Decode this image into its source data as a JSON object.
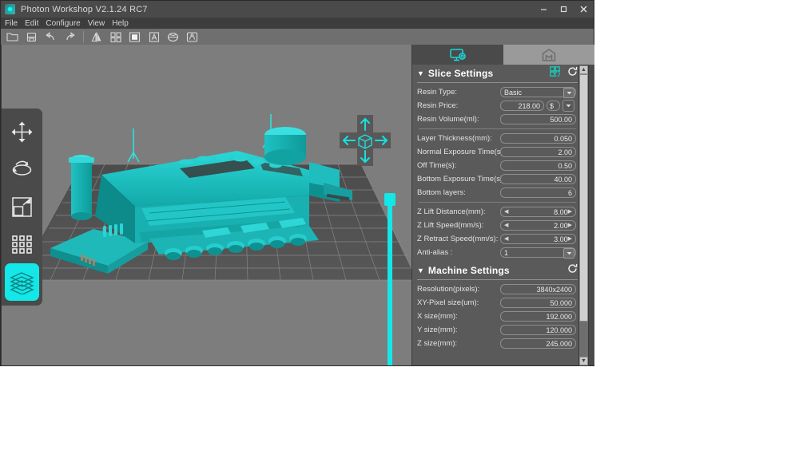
{
  "window": {
    "title": "Photon Workshop V2.1.24 RC7",
    "logo_icon": "photon-logo-icon",
    "controls": [
      {
        "name": "minimize-button",
        "glyph": "minimize-icon"
      },
      {
        "name": "maximize-button",
        "glyph": "maximize-icon"
      },
      {
        "name": "close-button",
        "glyph": "close-icon"
      }
    ]
  },
  "menubar": {
    "items": [
      {
        "label": "File"
      },
      {
        "label": "Edit"
      },
      {
        "label": "Configure"
      },
      {
        "label": "View"
      },
      {
        "label": "Help"
      }
    ]
  },
  "toolbar": {
    "buttons": [
      {
        "name": "open-file-button",
        "icon": "folder-open-icon"
      },
      {
        "name": "save-file-button",
        "icon": "save-disk-icon"
      },
      {
        "name": "undo-button",
        "icon": "undo-arrow-icon"
      },
      {
        "name": "redo-button",
        "icon": "redo-arrow-icon"
      },
      {
        "name": "mirror-button",
        "icon": "mirror-triangles-icon"
      },
      {
        "name": "hollow-button",
        "icon": "scatter-diamonds-icon"
      },
      {
        "name": "solid-view-button",
        "icon": "solid-square-icon"
      },
      {
        "name": "text-button",
        "icon": "letter-a-icon"
      },
      {
        "name": "hollow-sphere-button",
        "icon": "sliced-sphere-icon"
      },
      {
        "name": "supports-button",
        "icon": "support-model-icon"
      }
    ]
  },
  "viewport": {
    "tools": [
      {
        "name": "move-tool",
        "icon": "move-arrows-icon",
        "selected": false
      },
      {
        "name": "rotate-tool",
        "icon": "rotate-orbit-icon",
        "selected": false
      },
      {
        "name": "scale-tool",
        "icon": "scale-square-icon",
        "selected": false
      },
      {
        "name": "array-tool",
        "icon": "grid-dots-icon",
        "selected": false
      },
      {
        "name": "slice-tool",
        "icon": "layers-stack-icon",
        "selected": true
      }
    ],
    "gizmo": {
      "name": "view-navigation-gizmo",
      "center_icon": "cube-icon",
      "up_icon": "arrow-up-icon",
      "down_icon": "arrow-down-icon",
      "left_icon": "arrow-left-icon",
      "right_icon": "arrow-right-icon"
    },
    "z_slider": {
      "name": "z-height-slider"
    },
    "model": {
      "name": "locomotive-model",
      "color": "#17bfbf"
    },
    "background_color": "#7d7d7d",
    "plate_color": "#4f4f4f"
  },
  "panel": {
    "tabs": [
      {
        "name": "tab-slice-settings",
        "icon": "monitor-settings-icon",
        "active": true
      },
      {
        "name": "tab-print-preview",
        "icon": "printer-box-icon",
        "active": false
      }
    ],
    "slice": {
      "title": "Slice Settings",
      "caret": "▼",
      "copy_icon": "copy-settings-icon",
      "reset_icon": "reset-refresh-icon",
      "rows": [
        {
          "label": "Resin Type:",
          "value": "Basic",
          "type": "dropdown",
          "align": "left"
        },
        {
          "label": "Resin Price:",
          "value": "218.00",
          "currency": "$",
          "type": "price"
        },
        {
          "label": "Resin Volume(ml):",
          "value": "500.00",
          "type": "text"
        },
        {
          "label": "Layer Thickness(mm):",
          "value": "0.050",
          "type": "text"
        },
        {
          "label": "Normal Exposure Time(s):",
          "value": "2.00",
          "type": "text"
        },
        {
          "label": "Off Time(s):",
          "value": "0.50",
          "type": "text"
        },
        {
          "label": "Bottom Exposure Time(s):",
          "value": "40.00",
          "type": "text"
        },
        {
          "label": "Bottom layers:",
          "value": "6",
          "type": "text"
        },
        {
          "label": "Z Lift Distance(mm):",
          "value": "8.00",
          "type": "spin"
        },
        {
          "label": "Z Lift Speed(mm/s):",
          "value": "2.00",
          "type": "spin"
        },
        {
          "label": "Z Retract Speed(mm/s):",
          "value": "3.00",
          "type": "spin"
        },
        {
          "label": "Anti-alias :",
          "value": "1",
          "type": "dropdown",
          "align": "left"
        }
      ]
    },
    "machine": {
      "title": "Machine Settings",
      "caret": "▼",
      "reset_icon": "reset-refresh-icon",
      "rows": [
        {
          "label": "Resolution(pixels):",
          "value": "3840x2400",
          "type": "text"
        },
        {
          "label": "XY-Pixel size(um):",
          "value": "50.000",
          "type": "text"
        },
        {
          "label": "X size(mm):",
          "value": "192.000",
          "type": "text"
        },
        {
          "label": "Y size(mm):",
          "value": "120.000",
          "type": "text"
        },
        {
          "label": "Z size(mm):",
          "value": "245.000",
          "type": "text"
        }
      ]
    },
    "scrollbar": {
      "name": "panel-scrollbar",
      "up_glyph": "▲",
      "down_glyph": "▼"
    }
  },
  "colors": {
    "accent_cyan": "#13e7e7",
    "model_teal": "#17bfbf",
    "panel_bg": "#5a5a5a",
    "chrome_bg": "#4a4a4a"
  }
}
